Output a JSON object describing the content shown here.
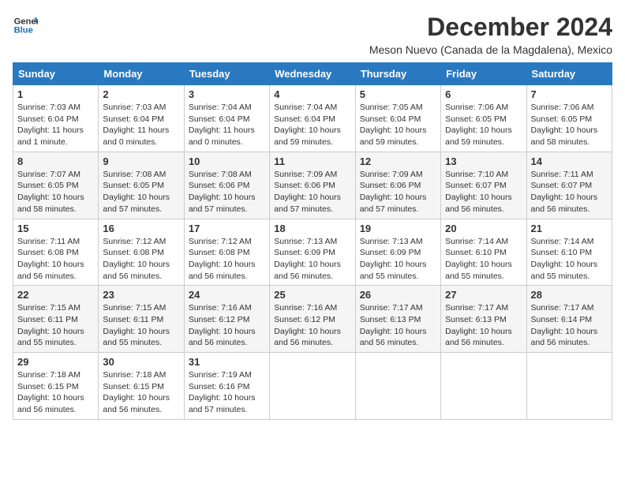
{
  "logo": {
    "line1": "General",
    "line2": "Blue"
  },
  "title": "December 2024",
  "subtitle": "Meson Nuevo (Canada de la Magdalena), Mexico",
  "days_of_week": [
    "Sunday",
    "Monday",
    "Tuesday",
    "Wednesday",
    "Thursday",
    "Friday",
    "Saturday"
  ],
  "weeks": [
    [
      {
        "day": "1",
        "rise": "7:03 AM",
        "set": "6:04 PM",
        "daylight": "11 hours and 1 minute."
      },
      {
        "day": "2",
        "rise": "7:03 AM",
        "set": "6:04 PM",
        "daylight": "11 hours and 0 minutes."
      },
      {
        "day": "3",
        "rise": "7:04 AM",
        "set": "6:04 PM",
        "daylight": "11 hours and 0 minutes."
      },
      {
        "day": "4",
        "rise": "7:04 AM",
        "set": "6:04 PM",
        "daylight": "10 hours and 59 minutes."
      },
      {
        "day": "5",
        "rise": "7:05 AM",
        "set": "6:04 PM",
        "daylight": "10 hours and 59 minutes."
      },
      {
        "day": "6",
        "rise": "7:06 AM",
        "set": "6:05 PM",
        "daylight": "10 hours and 59 minutes."
      },
      {
        "day": "7",
        "rise": "7:06 AM",
        "set": "6:05 PM",
        "daylight": "10 hours and 58 minutes."
      }
    ],
    [
      {
        "day": "8",
        "rise": "7:07 AM",
        "set": "6:05 PM",
        "daylight": "10 hours and 58 minutes."
      },
      {
        "day": "9",
        "rise": "7:08 AM",
        "set": "6:05 PM",
        "daylight": "10 hours and 57 minutes."
      },
      {
        "day": "10",
        "rise": "7:08 AM",
        "set": "6:06 PM",
        "daylight": "10 hours and 57 minutes."
      },
      {
        "day": "11",
        "rise": "7:09 AM",
        "set": "6:06 PM",
        "daylight": "10 hours and 57 minutes."
      },
      {
        "day": "12",
        "rise": "7:09 AM",
        "set": "6:06 PM",
        "daylight": "10 hours and 57 minutes."
      },
      {
        "day": "13",
        "rise": "7:10 AM",
        "set": "6:07 PM",
        "daylight": "10 hours and 56 minutes."
      },
      {
        "day": "14",
        "rise": "7:11 AM",
        "set": "6:07 PM",
        "daylight": "10 hours and 56 minutes."
      }
    ],
    [
      {
        "day": "15",
        "rise": "7:11 AM",
        "set": "6:08 PM",
        "daylight": "10 hours and 56 minutes."
      },
      {
        "day": "16",
        "rise": "7:12 AM",
        "set": "6:08 PM",
        "daylight": "10 hours and 56 minutes."
      },
      {
        "day": "17",
        "rise": "7:12 AM",
        "set": "6:08 PM",
        "daylight": "10 hours and 56 minutes."
      },
      {
        "day": "18",
        "rise": "7:13 AM",
        "set": "6:09 PM",
        "daylight": "10 hours and 56 minutes."
      },
      {
        "day": "19",
        "rise": "7:13 AM",
        "set": "6:09 PM",
        "daylight": "10 hours and 55 minutes."
      },
      {
        "day": "20",
        "rise": "7:14 AM",
        "set": "6:10 PM",
        "daylight": "10 hours and 55 minutes."
      },
      {
        "day": "21",
        "rise": "7:14 AM",
        "set": "6:10 PM",
        "daylight": "10 hours and 55 minutes."
      }
    ],
    [
      {
        "day": "22",
        "rise": "7:15 AM",
        "set": "6:11 PM",
        "daylight": "10 hours and 55 minutes."
      },
      {
        "day": "23",
        "rise": "7:15 AM",
        "set": "6:11 PM",
        "daylight": "10 hours and 55 minutes."
      },
      {
        "day": "24",
        "rise": "7:16 AM",
        "set": "6:12 PM",
        "daylight": "10 hours and 56 minutes."
      },
      {
        "day": "25",
        "rise": "7:16 AM",
        "set": "6:12 PM",
        "daylight": "10 hours and 56 minutes."
      },
      {
        "day": "26",
        "rise": "7:17 AM",
        "set": "6:13 PM",
        "daylight": "10 hours and 56 minutes."
      },
      {
        "day": "27",
        "rise": "7:17 AM",
        "set": "6:13 PM",
        "daylight": "10 hours and 56 minutes."
      },
      {
        "day": "28",
        "rise": "7:17 AM",
        "set": "6:14 PM",
        "daylight": "10 hours and 56 minutes."
      }
    ],
    [
      {
        "day": "29",
        "rise": "7:18 AM",
        "set": "6:15 PM",
        "daylight": "10 hours and 56 minutes."
      },
      {
        "day": "30",
        "rise": "7:18 AM",
        "set": "6:15 PM",
        "daylight": "10 hours and 56 minutes."
      },
      {
        "day": "31",
        "rise": "7:19 AM",
        "set": "6:16 PM",
        "daylight": "10 hours and 57 minutes."
      },
      null,
      null,
      null,
      null
    ]
  ],
  "labels": {
    "sunrise": "Sunrise:",
    "sunset": "Sunset:",
    "daylight": "Daylight:"
  }
}
